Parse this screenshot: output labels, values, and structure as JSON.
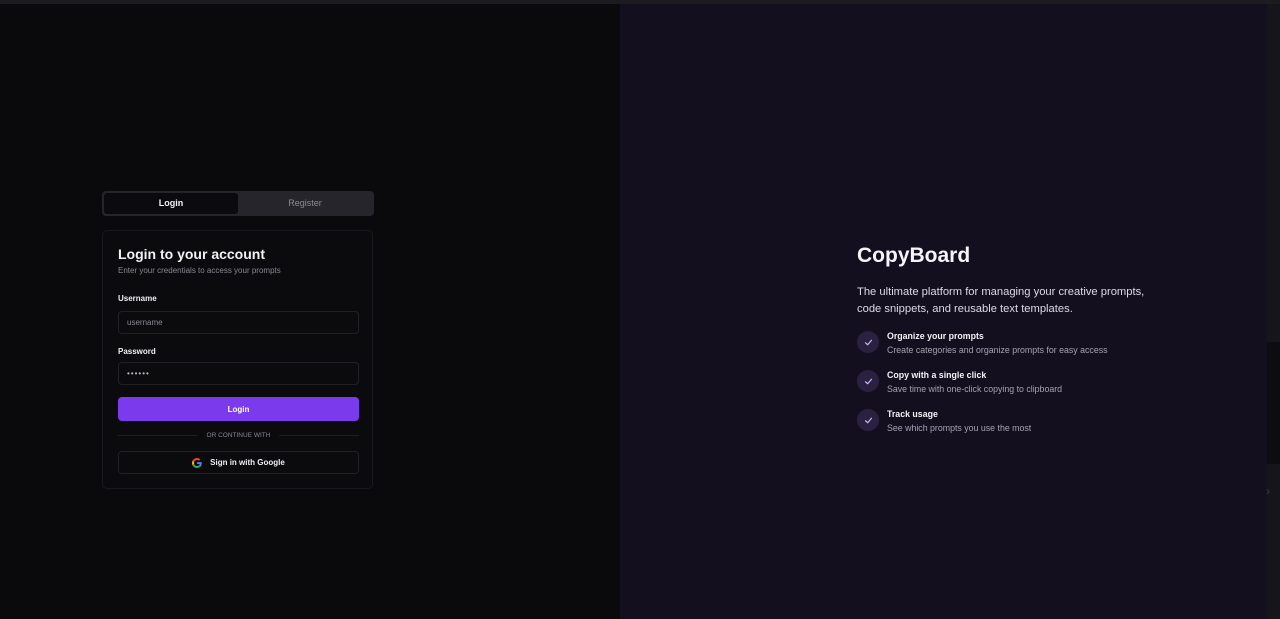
{
  "auth": {
    "tabs": [
      {
        "label": "Login",
        "active": true
      },
      {
        "label": "Register",
        "active": false
      }
    ],
    "card": {
      "title": "Login to your account",
      "subtitle": "Enter your credentials to access your prompts",
      "username": {
        "label": "Username",
        "placeholder": "username",
        "value": ""
      },
      "password": {
        "label": "Password",
        "value": "••••••"
      },
      "login_button": "Login",
      "divider": "OR CONTINUE WITH",
      "google_button": "Sign in with Google"
    }
  },
  "promo": {
    "title": "CopyBoard",
    "tagline": "The ultimate platform for managing your creative prompts, code snippets, and reusable text templates.",
    "features": [
      {
        "title": "Organize your prompts",
        "description": "Create categories and organize prompts for easy access"
      },
      {
        "title": "Copy with a single click",
        "description": "Save time with one-click copying to clipboard"
      },
      {
        "title": "Track usage",
        "description": "See which prompts you use the most"
      }
    ]
  },
  "icons": {
    "tab_check": "check-icon",
    "google": "google-icon",
    "edge_arrow": "chevron-right-icon"
  },
  "colors": {
    "accent": "#7c3aed",
    "left_background": "#0a090c",
    "right_background": "#130f1f",
    "check_badge": "#2a2140",
    "check_mark": "#c4b5fd"
  }
}
